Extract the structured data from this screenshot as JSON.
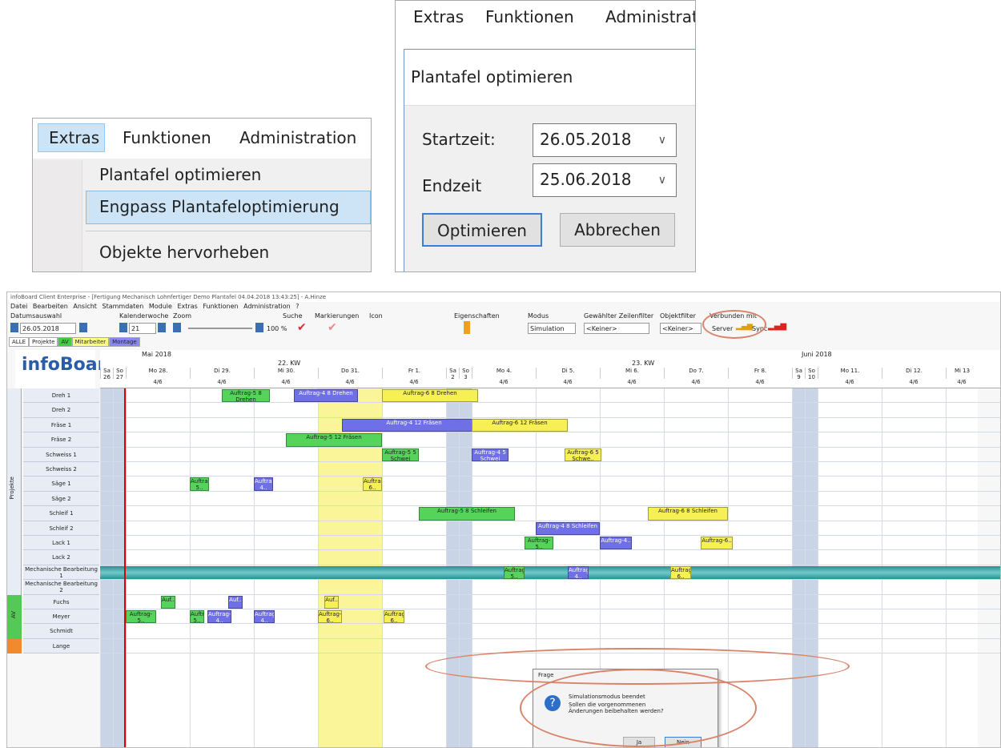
{
  "menu_crop": {
    "menus": [
      "Extras",
      "Funktionen",
      "Administration"
    ],
    "items": [
      "Plantafel optimieren",
      "Engpass Plantafeloptimierung",
      "Objekte hervorheben"
    ]
  },
  "dialog_crop": {
    "menus": [
      "Extras",
      "Funktionen",
      "Administrat"
    ],
    "title": "Plantafel optimieren",
    "start_label": "Startzeit:",
    "start_value": "26.05.2018",
    "end_label": "Endzeit",
    "end_value": "25.06.2018",
    "ok": "Optimieren",
    "cancel": "Abbrechen"
  },
  "app": {
    "title": "infoBoard Client Enterprise - [Fertigung Mechanisch Lohnfertiger Demo Plantafel 04.04.2018 13:43:25] - A.Hinze",
    "menus": [
      "Datei",
      "Bearbeiten",
      "Ansicht",
      "Stammdaten",
      "Module",
      "Extras",
      "Funktionen",
      "Administration",
      "?"
    ],
    "toolbar_labels": [
      "Datumsauswahl",
      "Kalenderwoche",
      "Zoom",
      "Suche",
      "Markierungen",
      "Icon",
      "Eigenschaften",
      "Modus",
      "Gewählter Zeilenfilter",
      "Objektfilter",
      "Verbunden mit"
    ],
    "date": "26.05.2018",
    "week": "21",
    "zoom": "100 %",
    "mode": "Simulation",
    "row_filter": "<Keiner>",
    "obj_filter": "<Keiner>",
    "server": "Server",
    "sync": "Sync",
    "tabs": [
      "ALLE",
      "Projekte",
      "AV",
      "Mitarbeiter",
      "Montage"
    ],
    "logo": "infoBoard",
    "months": [
      "Mai 2018",
      "Juni 2018"
    ],
    "weeks": [
      "22. KW",
      "23. KW"
    ],
    "days": [
      "Sa 26",
      "So 27",
      "Mo 28.",
      "Di 29.",
      "Mi 30.",
      "Do 31.",
      "Fr 1.",
      "Sa 2",
      "So 3",
      "Mo 4.",
      "Di 5.",
      "Mi 6.",
      "Do 7.",
      "Fr 8.",
      "Sa 9",
      "So 10",
      "Mo 11.",
      "Di 12.",
      "Mi 13"
    ],
    "cap": "4/6",
    "side_labels": [
      "Projekte",
      "AV"
    ],
    "rows": [
      "Dreh 1",
      "Dreh 2",
      "Fräse 1",
      "Fräse 2",
      "Schweiss 1",
      "Schweiss 2",
      "Säge 1",
      "Säge 2",
      "Schleif 1",
      "Schleif 2",
      "Lack 1",
      "Lack 2",
      "Mechanische Bearbeitung 1",
      "Mechanische Bearbeitung 2",
      "Fuchs",
      "Meyer",
      "Schmidt",
      "Lange"
    ],
    "tasks": {
      "t1": "Auftrag-5 8 Drehen",
      "t2": "Auftrag-4 8 Drehen",
      "t3": "Auftrag-6 8 Drehen",
      "t4": "Auftrag-4 12 Fräsen",
      "t5": "Auftrag-6 12 Fräsen",
      "t6": "Auftrag-5 12 Fräsen",
      "t7": "Auftrag-5 5 Schwei",
      "t8": "Auftrag-4 5 Schwei",
      "t9": "Auftrag-6 5 Schwe..",
      "t10": "Auftrag-5..",
      "t11": "Auftrag-4..",
      "t12": "Auftrag-6..",
      "t13": "Auftrag-5 8 Schleifen",
      "t14": "Auftrag-4 8 Schleifen",
      "t15": "Auftrag-6 8 Schleifen",
      "t16": "Auftrag-5..",
      "t17": "Auftrag-4..",
      "t18": "Auftrag-6..",
      "t19": "Auftrag-5..",
      "t20": "Auftrag-4..",
      "t21": "Auftrag-6..",
      "p1": "Auf..",
      "p2": "Auf..",
      "p3": "Auf..",
      "p4": "Auftrag-5..",
      "p5": "Auftrag-5..",
      "p6": "Auftrag-4..",
      "p7": "Auftrag-4..",
      "p8": "Auftrag-6..",
      "p9": "Auftrag-6.."
    },
    "dialog": {
      "title": "Frage",
      "line1": "Simulationsmodus beendet",
      "line2": "Sollen die vorgenommenen Änderungen beibehalten werden?",
      "yes": "Ja",
      "no": "Nein"
    }
  }
}
